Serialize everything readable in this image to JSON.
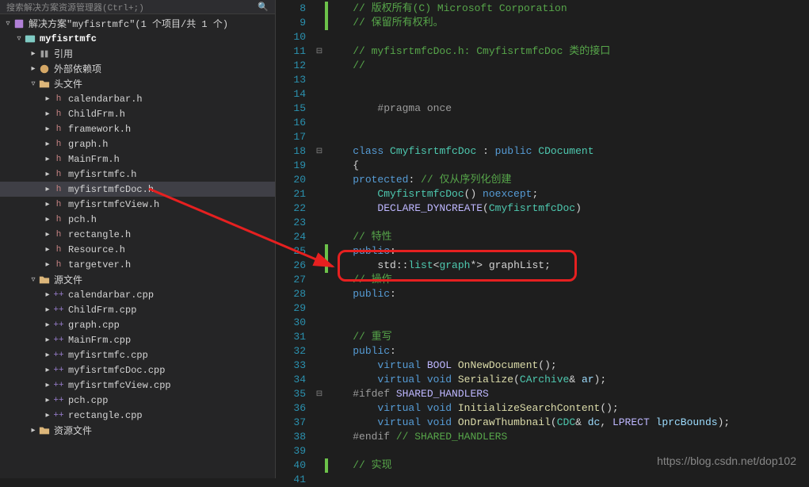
{
  "search_placeholder": "搜索解决方案资源管理器(Ctrl+;)",
  "solution_label": "解决方案\"myfisrtmfc\"(1 个项目/共 1 个)",
  "project_label": "myfisrtmfc",
  "ref_label": "引用",
  "ext_label": "外部依赖项",
  "headers_label": "头文件",
  "sources_label": "源文件",
  "resources_label": "资源文件",
  "header_files": [
    "calendarbar.h",
    "ChildFrm.h",
    "framework.h",
    "graph.h",
    "MainFrm.h",
    "myfisrtmfc.h",
    "myfisrtmfcDoc.h",
    "myfisrtmfcView.h",
    "pch.h",
    "rectangle.h",
    "Resource.h",
    "targetver.h"
  ],
  "source_files": [
    "calendarbar.cpp",
    "ChildFrm.cpp",
    "graph.cpp",
    "MainFrm.cpp",
    "myfisrtmfc.cpp",
    "myfisrtmfcDoc.cpp",
    "myfisrtmfcView.cpp",
    "pch.cpp",
    "rectangle.cpp"
  ],
  "line_start": 8,
  "line_end": 41,
  "code_lines": [
    {
      "t": "comment",
      "txt": "// 版权所有(C) Microsoft Corporation",
      "ind": 1,
      "gb": true
    },
    {
      "t": "comment",
      "txt": "// 保留所有权利。",
      "ind": 1,
      "gb": true
    },
    {
      "t": "empty",
      "txt": ""
    },
    {
      "t": "comment",
      "txt": "// myfisrtmfcDoc.h: CmyfisrtmfcDoc 类的接口",
      "ind": 1,
      "fold": "-"
    },
    {
      "t": "comment",
      "txt": "//",
      "ind": 1
    },
    {
      "t": "empty",
      "txt": ""
    },
    {
      "t": "empty",
      "txt": ""
    },
    {
      "t": "pre",
      "txt": "#pragma once",
      "ind": 2
    },
    {
      "t": "empty",
      "txt": ""
    },
    {
      "t": "empty",
      "txt": ""
    },
    {
      "t": "classdecl",
      "txt": "class CmyfisrtmfcDoc : public CDocument",
      "ind": 1,
      "fold": "-"
    },
    {
      "t": "punct",
      "txt": "{",
      "ind": 1
    },
    {
      "t": "protline",
      "txt": "protected: // 仅从序列化创建",
      "ind": 1
    },
    {
      "t": "ctor",
      "txt": "CmyfisrtmfcDoc() noexcept;",
      "ind": 2
    },
    {
      "t": "dyn",
      "txt": "DECLARE_DYNCREATE(CmyfisrtmfcDoc)",
      "ind": 2
    },
    {
      "t": "empty",
      "txt": ""
    },
    {
      "t": "comment",
      "txt": "// 特性",
      "ind": 1
    },
    {
      "t": "public",
      "txt": "public:",
      "ind": 1,
      "gb": true
    },
    {
      "t": "listline",
      "txt": "std::list<graph*> graphList;",
      "ind": 2,
      "gb": true
    },
    {
      "t": "comment",
      "txt": "// 操作",
      "ind": 1
    },
    {
      "t": "public",
      "txt": "public:",
      "ind": 1
    },
    {
      "t": "empty",
      "txt": "",
      "ind": 1
    },
    {
      "t": "empty",
      "txt": ""
    },
    {
      "t": "comment",
      "txt": "// 重写",
      "ind": 1
    },
    {
      "t": "public",
      "txt": "public:",
      "ind": 1
    },
    {
      "t": "vbool",
      "txt": "virtual BOOL OnNewDocument();",
      "ind": 2
    },
    {
      "t": "vser",
      "txt": "virtual void Serialize(CArchive& ar);",
      "ind": 2
    },
    {
      "t": "ifdef",
      "txt": "#ifdef SHARED_HANDLERS",
      "ind": 1,
      "fold": "-"
    },
    {
      "t": "vinit",
      "txt": "virtual void InitializeSearchContent();",
      "ind": 2
    },
    {
      "t": "vthumb",
      "txt": "virtual void OnDrawThumbnail(CDC& dc, LPRECT lprcBounds);",
      "ind": 2
    },
    {
      "t": "endif",
      "txt": "#endif // SHARED_HANDLERS",
      "ind": 1
    },
    {
      "t": "empty",
      "txt": ""
    },
    {
      "t": "comment",
      "txt": "// 实现",
      "ind": 1,
      "gb": true
    },
    {
      "t": "empty",
      "txt": ""
    }
  ],
  "watermark": "https://blog.csdn.net/dop102"
}
